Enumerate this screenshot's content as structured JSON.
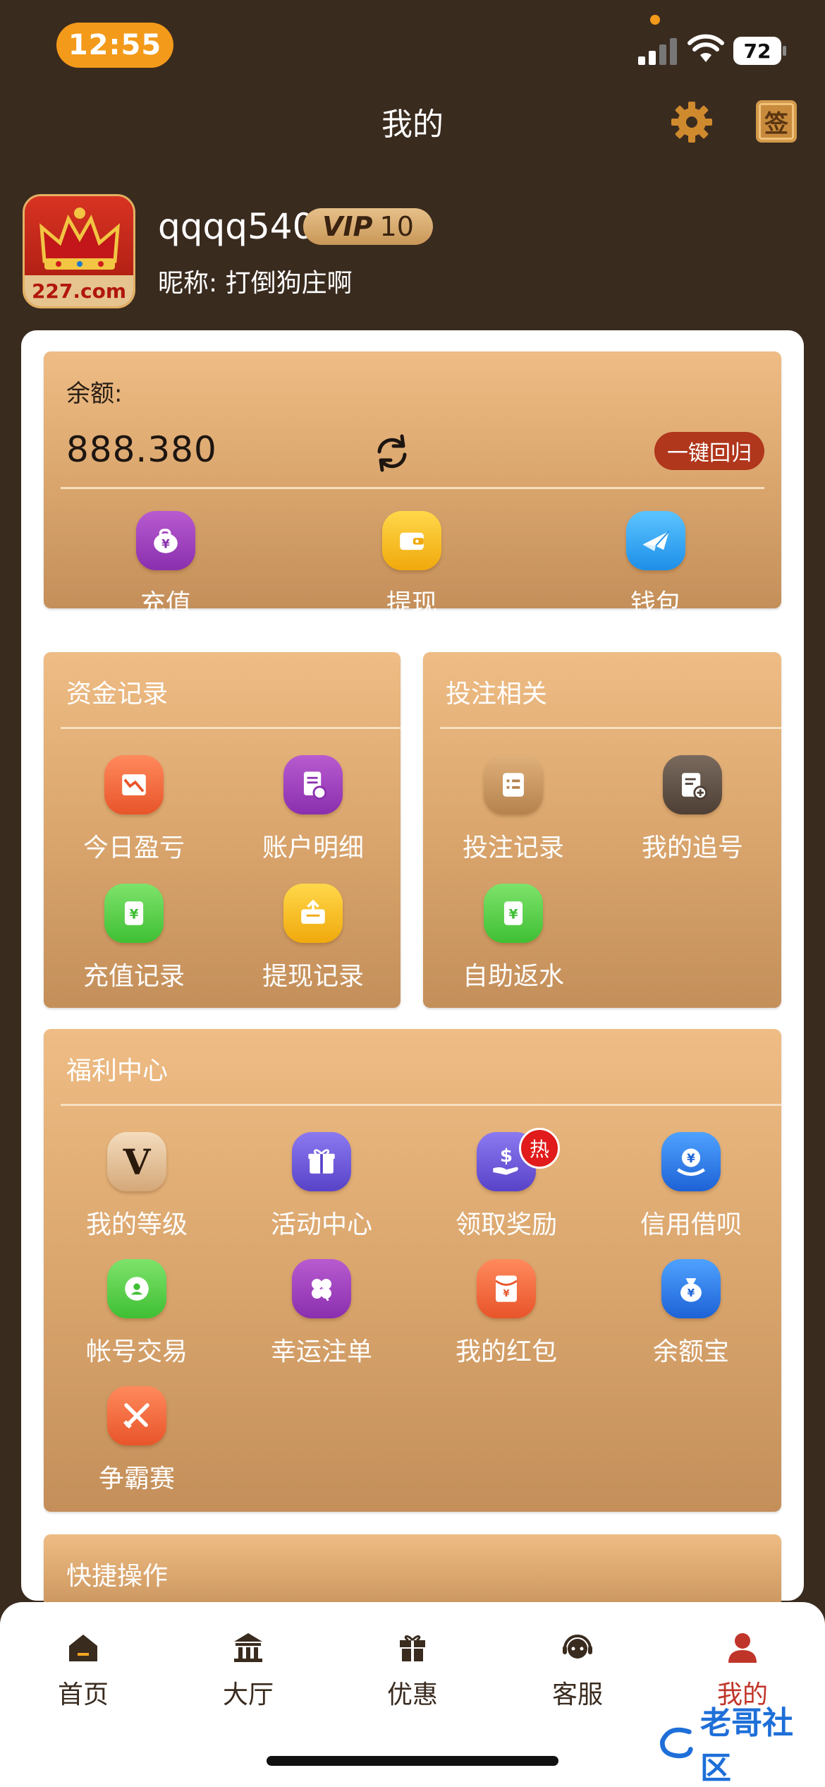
{
  "status": {
    "time": "12:55",
    "battery": "72"
  },
  "header": {
    "title": "我的",
    "sign_label": "签"
  },
  "profile": {
    "avatar_text": "227.com",
    "username": "qqqq540",
    "vip_text": "VIP",
    "vip_level": "10",
    "nickname": "昵称: 打倒狗庄啊"
  },
  "balance": {
    "label": "余额:",
    "value": "888.380",
    "return_label": "一键回归",
    "actions": [
      {
        "label": "充值",
        "icon": "piggy-bank-icon"
      },
      {
        "label": "提现",
        "icon": "wallet-icon"
      },
      {
        "label": "钱包",
        "icon": "paper-plane-icon"
      }
    ]
  },
  "funds": {
    "title": "资金记录",
    "items": [
      {
        "label": "今日盈亏",
        "icon": "trend-chart-icon"
      },
      {
        "label": "账户明细",
        "icon": "account-detail-icon"
      },
      {
        "label": "充值记录",
        "icon": "yen-ticket-icon"
      },
      {
        "label": "提现记录",
        "icon": "withdraw-box-icon"
      }
    ]
  },
  "betting": {
    "title": "投注相关",
    "items": [
      {
        "label": "投注记录",
        "icon": "bet-list-icon"
      },
      {
        "label": "我的追号",
        "icon": "add-document-icon"
      },
      {
        "label": "自助返水",
        "icon": "yen-ticket-icon"
      }
    ]
  },
  "welfare": {
    "title": "福利中心",
    "hot_label": "热",
    "items": [
      {
        "label": "我的等级",
        "icon": "vip-v-icon"
      },
      {
        "label": "活动中心",
        "icon": "gift-box-icon"
      },
      {
        "label": "领取奖励",
        "icon": "dollar-hand-icon"
      },
      {
        "label": "信用借呗",
        "icon": "yen-shield-icon"
      },
      {
        "label": "帐号交易",
        "icon": "account-shield-icon"
      },
      {
        "label": "幸运注单",
        "icon": "clover-icon"
      },
      {
        "label": "我的红包",
        "icon": "red-envelope-icon"
      },
      {
        "label": "余额宝",
        "icon": "money-bag-icon"
      },
      {
        "label": "争霸赛",
        "icon": "crossed-swords-icon"
      }
    ]
  },
  "quick": {
    "title": "快捷操作"
  },
  "tabs": [
    {
      "label": "首页",
      "icon": "home-icon"
    },
    {
      "label": "大厅",
      "icon": "hall-icon"
    },
    {
      "label": "优惠",
      "icon": "gift-icon"
    },
    {
      "label": "客服",
      "icon": "headset-icon"
    },
    {
      "label": "我的",
      "icon": "person-icon"
    }
  ],
  "watermark": "老哥社区",
  "colors": {
    "accent_active": "#c0352a",
    "background": "#3a2b1f",
    "panel_gold": "#d8a46c"
  }
}
